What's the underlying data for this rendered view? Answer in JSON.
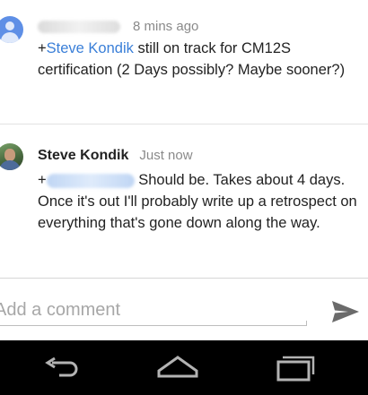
{
  "comments": [
    {
      "author": "",
      "time": "8 mins ago",
      "prefix": "+",
      "mention": "Steve Kondik",
      "text": " still on track for CM12S certification (2 Days possibly? Maybe sooner?)"
    },
    {
      "author": "Steve Kondik",
      "time": "Just now",
      "prefix": "+",
      "mention": "",
      "text": "Should be. Takes about 4 days. Once it's out I'll probably write up a retrospect on everything that's gone down along the way."
    }
  ],
  "composer": {
    "placeholder": "Add a comment",
    "value": "",
    "send_icon": "send-icon"
  },
  "nav": {
    "back_icon": "back-icon",
    "home_icon": "home-icon",
    "recents_icon": "recents-icon"
  },
  "colors": {
    "link": "#3a7fd8",
    "timestamp": "#8a8a8a",
    "nav_background": "#000000",
    "nav_icon": "#b3b3b3",
    "send_icon": "#6b6b6b"
  }
}
